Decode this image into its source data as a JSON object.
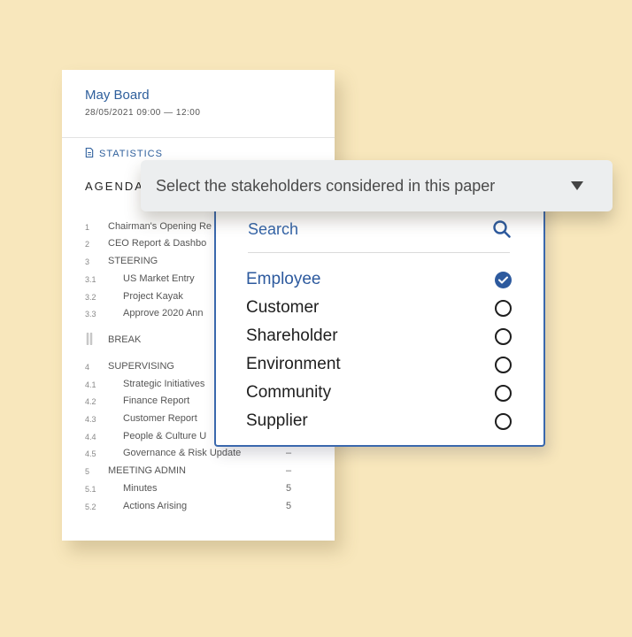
{
  "paper": {
    "title": "May Board",
    "date": "28/05/2021   09:00 — 12:00",
    "statistics_label": "STATISTICS",
    "agenda_heading": "AGENDA",
    "items": [
      {
        "num": "1",
        "label": "Chairman's Opening Re",
        "value": ""
      },
      {
        "num": "2",
        "label": "CEO Report & Dashbo",
        "value": ""
      },
      {
        "num": "3",
        "label": "STEERING",
        "value": ""
      },
      {
        "num": "3.1",
        "label": "US Market Entry",
        "value": ""
      },
      {
        "num": "3.2",
        "label": "Project Kayak",
        "value": ""
      },
      {
        "num": "3.3",
        "label": "Approve 2020 Ann",
        "value": ""
      },
      {
        "num": "",
        "label": "BREAK",
        "value": ""
      },
      {
        "num": "4",
        "label": "SUPERVISING",
        "value": ""
      },
      {
        "num": "4.1",
        "label": "Strategic Initiatives",
        "value": ""
      },
      {
        "num": "4.2",
        "label": "Finance Report",
        "value": ""
      },
      {
        "num": "4.3",
        "label": "Customer Report",
        "value": ""
      },
      {
        "num": "4.4",
        "label": "People & Culture U",
        "value": ""
      },
      {
        "num": "4.5",
        "label": "Governance & Risk Update",
        "value": "–"
      },
      {
        "num": "5",
        "label": "MEETING ADMIN",
        "value": "–"
      },
      {
        "num": "5.1",
        "label": "Minutes",
        "value": "5"
      },
      {
        "num": "5.2",
        "label": "Actions Arising",
        "value": "5"
      }
    ]
  },
  "select": {
    "placeholder": "Select the stakeholders considered in this paper"
  },
  "dropdown": {
    "search_label": "Search",
    "options": [
      {
        "label": "Employee",
        "selected": true
      },
      {
        "label": "Customer",
        "selected": false
      },
      {
        "label": "Shareholder",
        "selected": false
      },
      {
        "label": "Environment",
        "selected": false
      },
      {
        "label": "Community",
        "selected": false
      },
      {
        "label": "Supplier",
        "selected": false
      }
    ]
  },
  "colors": {
    "background": "#f8e7bc",
    "accent": "#2d5a9e"
  },
  "icons": {
    "statistics": "document-icon",
    "break": "coffee-icon",
    "search": "search-icon",
    "dropdown": "caret-down-icon",
    "checked": "checkmark-icon"
  }
}
